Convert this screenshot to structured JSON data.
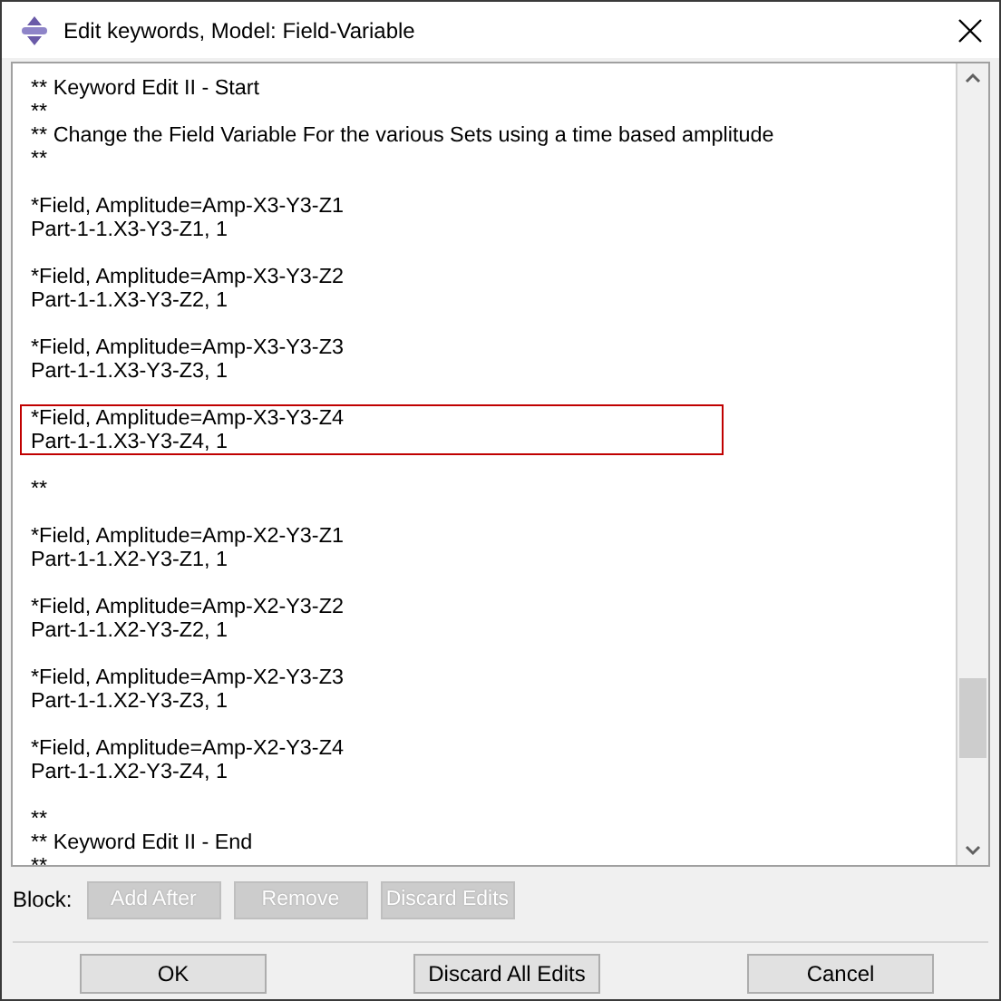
{
  "window": {
    "title": "Edit keywords, Model: Field-Variable"
  },
  "editor": {
    "blocks": [
      {
        "lines": [
          "** Keyword Edit II - Start",
          "**",
          "** Change the Field Variable For the various Sets using a time based amplitude",
          "**"
        ],
        "selected": false
      },
      {
        "lines": [
          "*Field, Amplitude=Amp-X3-Y3-Z1",
          "Part-1-1.X3-Y3-Z1, 1"
        ],
        "selected": false
      },
      {
        "lines": [
          "*Field, Amplitude=Amp-X3-Y3-Z2",
          "Part-1-1.X3-Y3-Z2, 1"
        ],
        "selected": false
      },
      {
        "lines": [
          "*Field, Amplitude=Amp-X3-Y3-Z3",
          "Part-1-1.X3-Y3-Z3, 1"
        ],
        "selected": false
      },
      {
        "lines": [
          "*Field, Amplitude=Amp-X3-Y3-Z4",
          "Part-1-1.X3-Y3-Z4, 1"
        ],
        "selected": true
      },
      {
        "lines": [
          "**"
        ],
        "selected": false
      },
      {
        "lines": [
          "*Field, Amplitude=Amp-X2-Y3-Z1",
          "Part-1-1.X2-Y3-Z1, 1"
        ],
        "selected": false
      },
      {
        "lines": [
          "*Field, Amplitude=Amp-X2-Y3-Z2",
          "Part-1-1.X2-Y3-Z2, 1"
        ],
        "selected": false
      },
      {
        "lines": [
          "*Field, Amplitude=Amp-X2-Y3-Z3",
          "Part-1-1.X2-Y3-Z3, 1"
        ],
        "selected": false
      },
      {
        "lines": [
          "*Field, Amplitude=Amp-X2-Y3-Z4",
          "Part-1-1.X2-Y3-Z4, 1"
        ],
        "selected": false
      },
      {
        "lines": [
          "**",
          "** Keyword Edit II - End",
          "**"
        ],
        "selected": false
      }
    ]
  },
  "block_bar": {
    "label": "Block:",
    "buttons": [
      {
        "label": "Add After",
        "disabled": true
      },
      {
        "label": "Remove",
        "disabled": true
      },
      {
        "label": "Discard Edits",
        "disabled": true
      }
    ]
  },
  "buttons": [
    {
      "label": "OK"
    },
    {
      "label": "Discard All Edits"
    },
    {
      "label": "Cancel"
    }
  ]
}
